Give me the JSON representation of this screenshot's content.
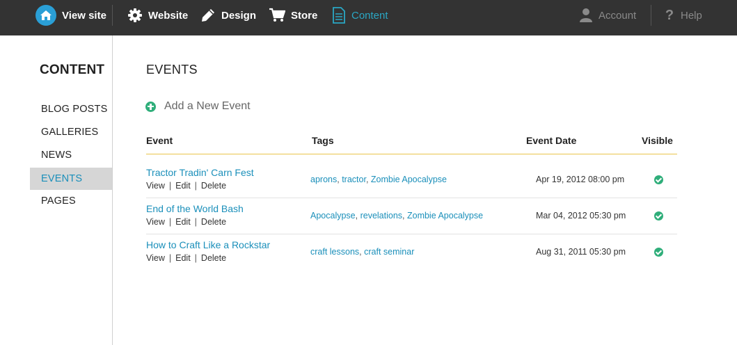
{
  "topbar": {
    "view_site": "View site",
    "website": "Website",
    "design": "Design",
    "store": "Store",
    "content": "Content",
    "account": "Account",
    "help": "Help"
  },
  "sidebar": {
    "title": "CONTENT",
    "items": [
      {
        "label": "BLOG POSTS"
      },
      {
        "label": "GALLERIES"
      },
      {
        "label": "NEWS"
      },
      {
        "label": "EVENTS"
      },
      {
        "label": "PAGES"
      }
    ],
    "active": "EVENTS"
  },
  "main": {
    "title": "EVENTS",
    "add_label": "Add a New Event",
    "columns": {
      "event": "Event",
      "tags": "Tags",
      "date": "Event Date",
      "visible": "Visible"
    },
    "actions": {
      "view": "View",
      "edit": "Edit",
      "delete": "Delete",
      "sep": "|"
    },
    "events": [
      {
        "title": "Tractor Tradin' Carn Fest",
        "tags": [
          "aprons",
          "tractor",
          "Zombie Apocalypse"
        ],
        "date": "Apr 19, 2012 08:00 pm",
        "visible": true
      },
      {
        "title": "End of the World Bash",
        "tags": [
          "Apocalypse",
          "revelations",
          "Zombie Apocalypse"
        ],
        "date": "Mar 04, 2012 05:30 pm",
        "visible": true
      },
      {
        "title": "How to Craft Like a Rockstar",
        "tags": [
          "craft lessons",
          "craft seminar"
        ],
        "date": "Aug 31, 2011 05:30 pm",
        "visible": true
      }
    ]
  },
  "colors": {
    "topbar": "#333333",
    "accent": "#2aa7c4",
    "link": "#1a8fba",
    "header_rule": "#e9c44a",
    "visible_check": "#2fae7a"
  }
}
